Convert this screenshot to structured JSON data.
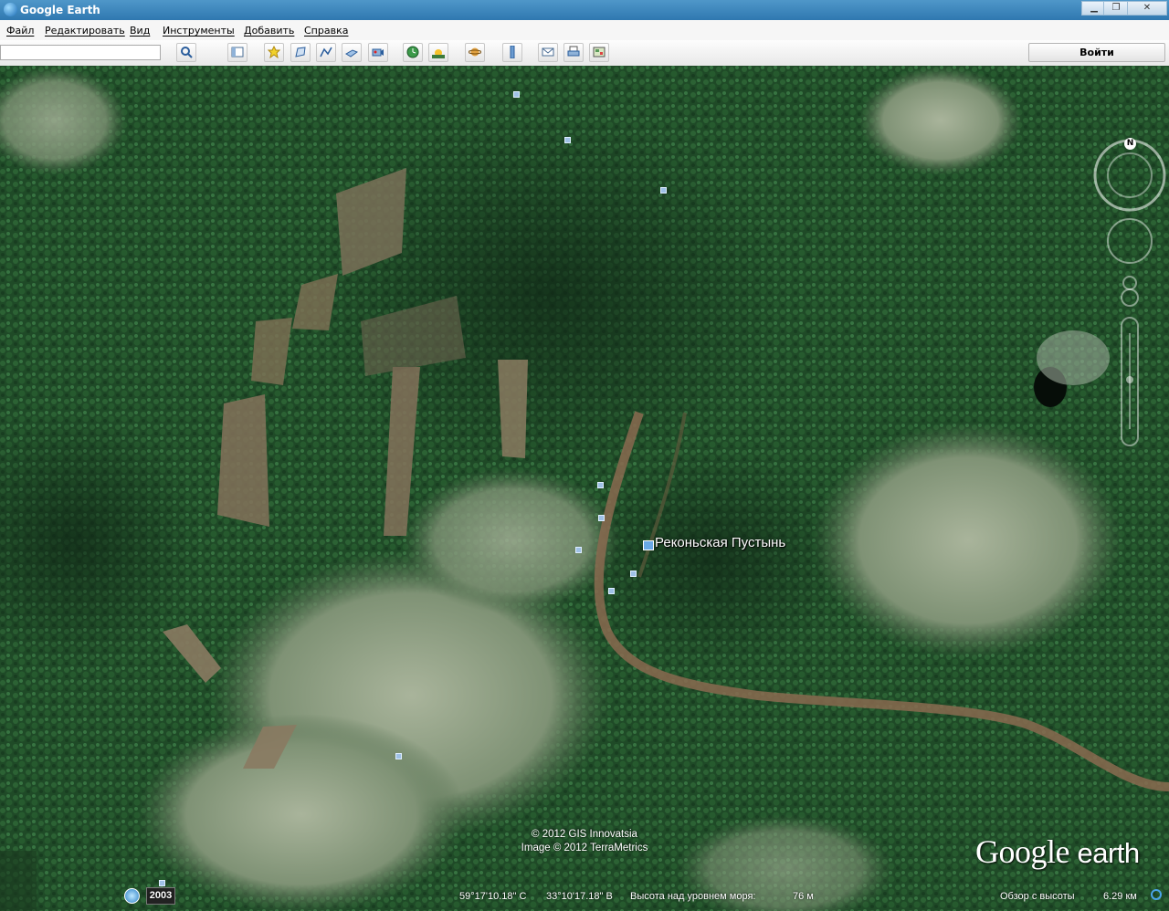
{
  "window": {
    "title": "Google Earth",
    "minimize_label": "▁",
    "restore_label": "❐",
    "close_label": "✕"
  },
  "menu": {
    "items": [
      "Файл",
      "Редактировать",
      "Вид",
      "Инструменты",
      "Добавить",
      "Справка"
    ]
  },
  "toolbar": {
    "search_placeholder": "",
    "signin_label": "Войти",
    "buttons": [
      "search-icon",
      "sidebar-toggle-icon",
      "placemark-icon",
      "polygon-icon",
      "path-icon",
      "image-overlay-icon",
      "record-tour-icon",
      "historical-imagery-icon",
      "sunlight-icon",
      "planets-icon",
      "ruler-icon",
      "email-icon",
      "print-icon",
      "map-view-icon"
    ]
  },
  "map": {
    "place_label": "Реконьская Пустынь",
    "copyright_line1": "© 2012 GIS Innovatsia",
    "copyright_line2": "Image © 2012 TerraMetrics",
    "logo_google": "Google",
    "logo_earth": "earth"
  },
  "navigation": {
    "north_label": "N"
  },
  "status": {
    "year": "2003",
    "latitude": "59°17'10.18\" С",
    "longitude": "33°10'17.18\" В",
    "elevation_label": "Высота над уровнем моря:",
    "elevation_value": "76 м",
    "eye_alt_label": "Обзор с высоты",
    "eye_alt_value": "6.29 км"
  },
  "colors": {
    "titlebar": "#3a86be",
    "forest": "#1e4a28",
    "clearing": "#8f9c82",
    "road": "#8a6a50"
  }
}
